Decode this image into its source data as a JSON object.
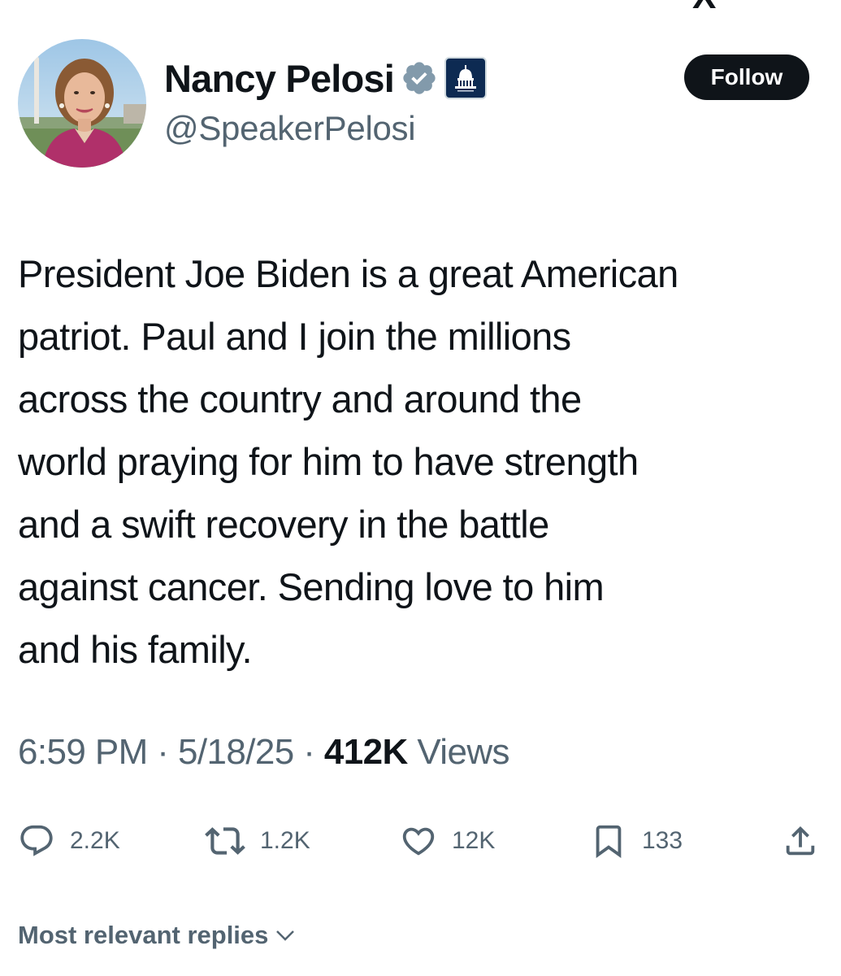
{
  "header_fragment": "X",
  "author": {
    "name": "Nancy Pelosi",
    "handle": "@SpeakerPelosi",
    "verified_badge_color": "#829aab",
    "affiliate_badge_color": "#0d2a52"
  },
  "follow_button": {
    "label": "Follow",
    "color": "#0f1419"
  },
  "tweet": {
    "text_lines": [
      "President Joe Biden is a great American",
      "patriot. Paul and I join the millions",
      "across the country and around the",
      "world praying for him to have strength",
      "and a swift recovery in the battle",
      "against cancer. Sending love to him",
      "and his family."
    ],
    "time": "6:59 PM",
    "separator": " · ",
    "date": "5/18/25",
    "views_count": "412K",
    "views_label": " Views"
  },
  "actions": {
    "reply": {
      "icon": "reply-icon",
      "count": "2.2K"
    },
    "repost": {
      "icon": "repost-icon",
      "count": "1.2K"
    },
    "like": {
      "icon": "heart-icon",
      "count": "12K"
    },
    "bookmark": {
      "icon": "bookmark-icon",
      "count": "133"
    },
    "share": {
      "icon": "share-icon"
    }
  },
  "replies_sort": {
    "label": "Most relevant replies",
    "icon": "chevron-down-icon"
  },
  "colors": {
    "text_primary": "#0f1419",
    "text_secondary": "#536471"
  }
}
